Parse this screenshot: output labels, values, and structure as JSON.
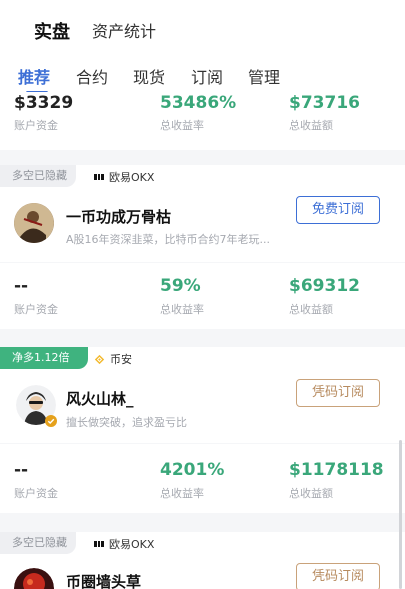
{
  "header": {
    "main_tabs": [
      {
        "label": "实盘",
        "active": true
      },
      {
        "label": "资产统计",
        "active": false
      }
    ],
    "sub_tabs": [
      {
        "label": "推荐",
        "active": true
      },
      {
        "label": "合约",
        "active": false
      },
      {
        "label": "现货",
        "active": false
      },
      {
        "label": "订阅",
        "active": false
      },
      {
        "label": "管理",
        "active": false
      }
    ]
  },
  "top_stats": {
    "capital": "$3329",
    "capital_label": "账户资金",
    "return_rate": "53486%",
    "return_rate_label": "总收益率",
    "profit": "$73716",
    "profit_label": "总收益额"
  },
  "cards": [
    {
      "tag": "多空已隐藏",
      "tag_style": "gray",
      "exchange": "欧易OKX",
      "exchange_icon": "okx-icon",
      "name": "一币功成万骨枯",
      "description": "A股16年资深韭菜，比特币合约7年老玩...",
      "button": "免费订阅",
      "stats": {
        "capital": "--",
        "capital_label": "账户资金",
        "return_rate": "59%",
        "return_rate_label": "总收益率",
        "profit": "$69312",
        "profit_label": "总收益额"
      }
    },
    {
      "tag": "净多1.12倍",
      "tag_style": "green",
      "exchange": "币安",
      "exchange_icon": "binance-icon",
      "name": "风火山林_",
      "description": "擅长做突破，追求盈亏比",
      "button": "凭码订阅",
      "stats": {
        "capital": "--",
        "capital_label": "账户资金",
        "return_rate": "4201%",
        "return_rate_label": "总收益率",
        "profit": "$1178118",
        "profit_label": "总收益额"
      }
    },
    {
      "tag": "多空已隐藏",
      "tag_style": "gray",
      "exchange": "欧易OKX",
      "exchange_icon": "okx-icon",
      "name": "币圈墙头草",
      "button": "凭码订阅"
    }
  ],
  "colors": {
    "accent_blue": "#3d6fd6",
    "positive_green": "#3aa77a",
    "tag_green": "#3fb37f",
    "code_button": "#b78b5f",
    "binance_yellow": "#f3ba2f"
  }
}
